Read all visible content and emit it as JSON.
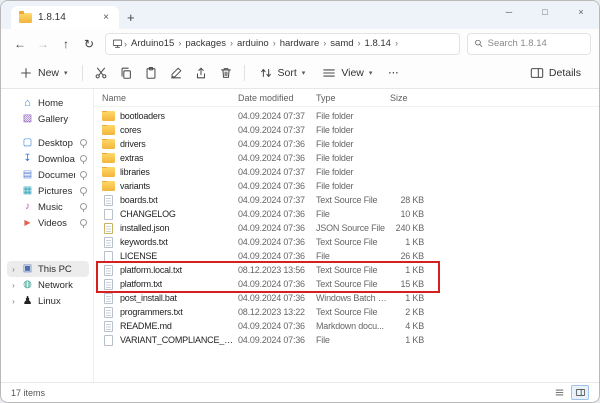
{
  "window": {
    "tab_title": "1.8.14",
    "tab_close": "×",
    "new_tab": "+",
    "status_items": "17 items",
    "controls": {
      "minimize": "─",
      "maximize": "□",
      "close": "×"
    }
  },
  "chrome": {
    "back": "←",
    "forward": "→",
    "up": "↑",
    "refresh": "↻",
    "crumb_sep": "›",
    "chevron_down": "▾",
    "more": "⋯"
  },
  "breadcrumb": {
    "items": [
      "Arduino15",
      "packages",
      "arduino",
      "hardware",
      "samd",
      "1.8.14"
    ]
  },
  "search": {
    "placeholder": "Search 1.8.14"
  },
  "toolbar": {
    "new_label": "New",
    "sort_label": "Sort",
    "view_label": "View",
    "details_label": "Details"
  },
  "sidebar": {
    "groups": [
      {
        "items": [
          {
            "label": "Home",
            "icon": "home-icon"
          },
          {
            "label": "Gallery",
            "icon": "gallery-icon"
          }
        ]
      },
      {
        "items": [
          {
            "label": "Desktop",
            "icon": "desktop-icon",
            "pinned": true
          },
          {
            "label": "Downloads",
            "icon": "downloads-icon",
            "pinned": true
          },
          {
            "label": "Documents",
            "icon": "documents-icon",
            "pinned": true
          },
          {
            "label": "Pictures",
            "icon": "pictures-icon",
            "pinned": true
          },
          {
            "label": "Music",
            "icon": "music-icon",
            "pinned": true
          },
          {
            "label": "Videos",
            "icon": "videos-icon",
            "pinned": true
          }
        ]
      },
      {
        "items": [
          {
            "label": "This PC",
            "icon": "this-pc-icon",
            "chevron": true,
            "selected": true
          },
          {
            "label": "Network",
            "icon": "network-icon",
            "chevron": true
          },
          {
            "label": "Linux",
            "icon": "linux-icon",
            "chevron": true
          }
        ]
      }
    ]
  },
  "filelist": {
    "columns": [
      "Name",
      "Date modified",
      "Type",
      "Size"
    ],
    "rows": [
      {
        "name": "bootloaders",
        "date": "04.09.2024 07:37",
        "type": "File folder",
        "size": "",
        "icon": "folder-icon"
      },
      {
        "name": "cores",
        "date": "04.09.2024 07:37",
        "type": "File folder",
        "size": "",
        "icon": "folder-icon"
      },
      {
        "name": "drivers",
        "date": "04.09.2024 07:36",
        "type": "File folder",
        "size": "",
        "icon": "folder-icon"
      },
      {
        "name": "extras",
        "date": "04.09.2024 07:36",
        "type": "File folder",
        "size": "",
        "icon": "folder-icon"
      },
      {
        "name": "libraries",
        "date": "04.09.2024 07:37",
        "type": "File folder",
        "size": "",
        "icon": "folder-icon"
      },
      {
        "name": "variants",
        "date": "04.09.2024 07:36",
        "type": "File folder",
        "size": "",
        "icon": "folder-icon"
      },
      {
        "name": "boards.txt",
        "date": "04.09.2024 07:37",
        "type": "Text Source File",
        "size": "28 KB",
        "icon": "text-file-icon"
      },
      {
        "name": "CHANGELOG",
        "date": "04.09.2024 07:36",
        "type": "File",
        "size": "10 KB",
        "icon": "file-icon"
      },
      {
        "name": "installed.json",
        "date": "04.09.2024 07:36",
        "type": "JSON Source File",
        "size": "240 KB",
        "icon": "json-file-icon"
      },
      {
        "name": "keywords.txt",
        "date": "04.09.2024 07:36",
        "type": "Text Source File",
        "size": "1 KB",
        "icon": "text-file-icon"
      },
      {
        "name": "LICENSE",
        "date": "04.09.2024 07:36",
        "type": "File",
        "size": "26 KB",
        "icon": "file-icon"
      },
      {
        "name": "platform.local.txt",
        "date": "08.12.2023 13:56",
        "type": "Text Source File",
        "size": "1 KB",
        "icon": "text-file-icon",
        "highlighted": true
      },
      {
        "name": "platform.txt",
        "date": "04.09.2024 07:36",
        "type": "Text Source File",
        "size": "15 KB",
        "icon": "text-file-icon",
        "highlighted": true
      },
      {
        "name": "post_install.bat",
        "date": "04.09.2024 07:36",
        "type": "Windows Batch File",
        "size": "1 KB",
        "icon": "batch-file-icon"
      },
      {
        "name": "programmers.txt",
        "date": "08.12.2023 13:22",
        "type": "Text Source File",
        "size": "2 KB",
        "icon": "text-file-icon"
      },
      {
        "name": "README.md",
        "date": "04.09.2024 07:36",
        "type": "Markdown docu...",
        "size": "4 KB",
        "icon": "markdown-file-icon"
      },
      {
        "name": "VARIANT_COMPLIANCE_CHANGELOG",
        "date": "04.09.2024 07:36",
        "type": "File",
        "size": "1 KB",
        "icon": "file-icon"
      }
    ]
  },
  "colors": {
    "highlight_box": "#d61f1f",
    "accent": "#0067c0",
    "folder": "#fcbe45"
  }
}
